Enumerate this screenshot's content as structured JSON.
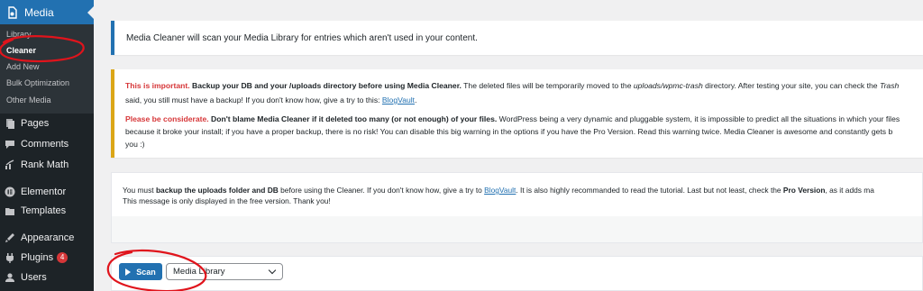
{
  "sidebar": {
    "active_menu": {
      "label": "Media",
      "icon": "media-icon"
    },
    "submenu": [
      {
        "label": "Library",
        "current": false
      },
      {
        "label": "Cleaner",
        "current": true
      },
      {
        "label": "Add New",
        "current": false
      },
      {
        "label": "Bulk Optimization",
        "current": false
      },
      {
        "label": "Other Media",
        "current": false
      }
    ],
    "items": [
      {
        "label": "Pages",
        "icon": "pages-icon"
      },
      {
        "label": "Comments",
        "icon": "comments-icon"
      },
      {
        "label": "Rank Math",
        "icon": "rank-math-icon"
      },
      {
        "label": "Elementor",
        "icon": "elementor-icon"
      },
      {
        "label": "Templates",
        "icon": "templates-icon"
      },
      {
        "label": "Appearance",
        "icon": "appearance-icon"
      },
      {
        "label": "Plugins",
        "icon": "plugins-icon",
        "badge": "4"
      },
      {
        "label": "Users",
        "icon": "users-icon"
      }
    ]
  },
  "info_notice": "Media Cleaner will scan your Media Library for entries which aren't used in your content.",
  "warning": {
    "p1": {
      "lead": "This is important.",
      "bold": " Backup your DB and your /uploads directory before using Media Cleaner.",
      "text_a": " The deleted files will be temporarily moved to the ",
      "path": "uploads/wpmc-trash",
      "text_b": " directory. After testing your site, you can check the ",
      "trash": "Trash",
      "line2": "said, you still must have a backup! If you don't know how, give a try to this: ",
      "link": "BlogVault",
      "line2_end": "."
    },
    "p2": {
      "lead": "Please be considerate.",
      "bold": " Don't blame Media Cleaner if it deleted too many (or not enough) of your files.",
      "text": " WordPress being a very dynamic and pluggable system, it is impossible to predict all the situations in which your files",
      "line2": "because it broke your install; if you have a proper backup, there is no risk! You can disable this big warning in the options if you have the Pro Version. Read this warning twice. Media Cleaner is awesome and constantly gets b",
      "line3": "you :)"
    }
  },
  "free_notice": {
    "a": "You must ",
    "b": "backup the uploads folder and DB",
    "c": " before using the Cleaner. If you don't know how, give a try to ",
    "link": "BlogVault",
    "d": ". It is also highly recommanded to read the tutorial. Last but not least, check the ",
    "pro": "Pro Version",
    "e": ", as it adds ma",
    "line2": "This message is only displayed in the free version. Thank you!"
  },
  "toolbar": {
    "scan_label": "Scan",
    "source_select_value": "Media Library"
  },
  "colors": {
    "accent": "#2271b1",
    "sidebar_bg": "#1d2327",
    "warning_border": "#dba617",
    "alert_red": "#d63638",
    "annotation_red": "#e0141c"
  }
}
